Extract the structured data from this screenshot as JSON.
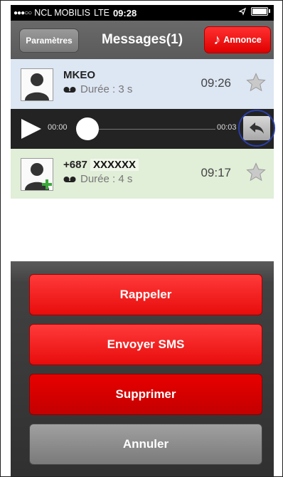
{
  "status_bar": {
    "signal_dots": "●●●○○",
    "carrier": "NCL MOBILIS",
    "network": "LTE",
    "time": "09:28"
  },
  "nav": {
    "title": "Messages(1)",
    "settings_label": "Paramètres",
    "announce_label": "Annonce"
  },
  "messages": [
    {
      "name": "MKEO",
      "duration": "Durée : 3 s",
      "time": "09:26",
      "starred": false,
      "has_plus_icon": false
    },
    {
      "name_prefix": "+687",
      "name_masked": "XXXXXX",
      "duration": "Durée : 4 s",
      "time": "09:17",
      "starred": false,
      "has_plus_icon": true
    }
  ],
  "player": {
    "position": "00:00",
    "length": "00:03",
    "progress": 0
  },
  "action_sheet": {
    "callback": "Rappeler",
    "send_sms": "Envoyer SMS",
    "delete": "Supprimer",
    "cancel": "Annuler"
  },
  "colors": {
    "nav_bg": "#5f5f5f",
    "red": "#e80c0c",
    "dark_red": "#c30000",
    "row_selected": "#dde6f3",
    "row_new": "#e1eed8",
    "highlight_circle": "#2a3fa8"
  },
  "icons": [
    "signal-dots-icon",
    "location-arrow-icon",
    "battery-icon",
    "music-note-icon",
    "contact-silhouette-icon",
    "voicemail-icon",
    "star-icon",
    "play-icon",
    "reply-arrow-icon",
    "add-contact-icon"
  ]
}
